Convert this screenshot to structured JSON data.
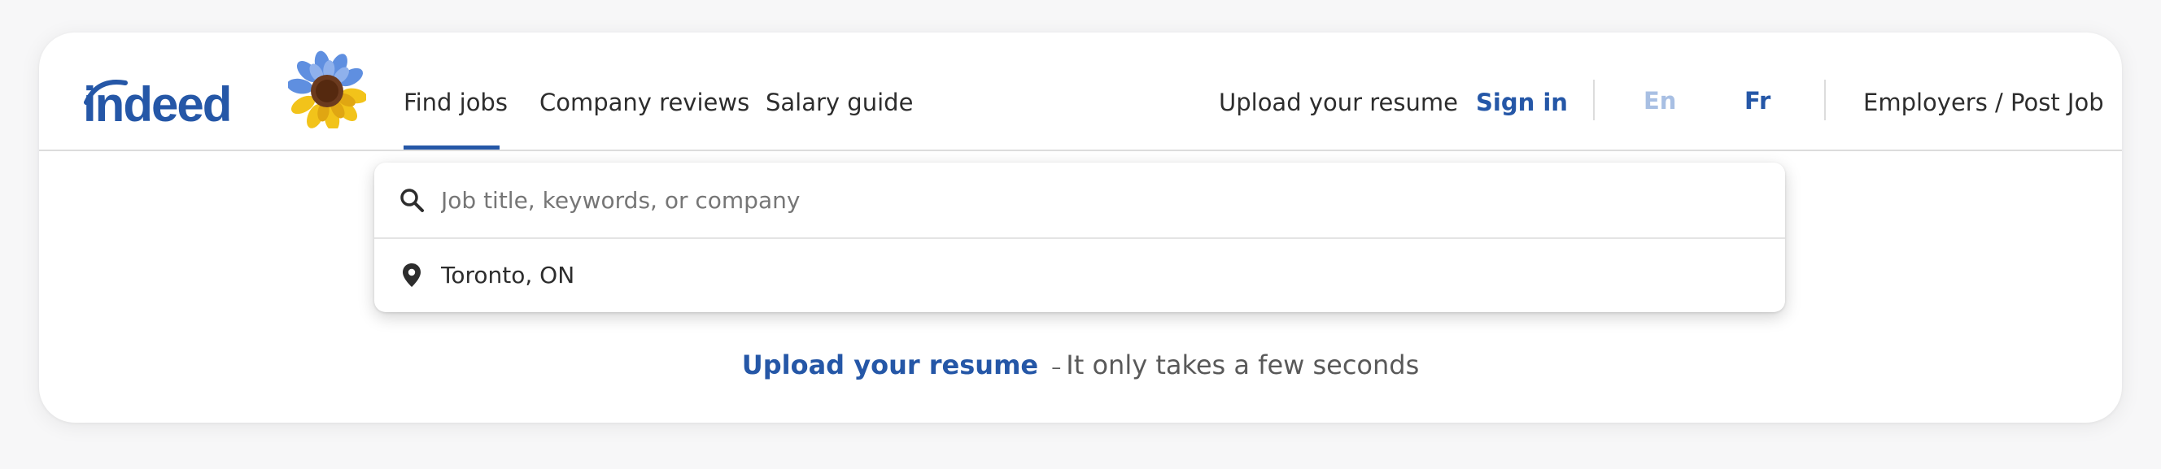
{
  "brand": {
    "logo_text": "indeed",
    "logo_color": "#2557a7"
  },
  "nav": {
    "items": [
      {
        "label": "Find jobs",
        "active": true
      },
      {
        "label": "Company reviews",
        "active": false
      },
      {
        "label": "Salary guide",
        "active": false
      }
    ],
    "right": {
      "upload_resume": "Upload your resume",
      "sign_in": "Sign in",
      "lang_en": "En",
      "lang_fr": "Fr",
      "employers": "Employers / Post Job"
    }
  },
  "search": {
    "what_placeholder": "Job title, keywords, or company",
    "what_value": "",
    "where_value": "Toronto, ON",
    "icons": [
      "search-icon",
      "location-pin-icon"
    ]
  },
  "promo": {
    "link_text": "Upload your resume",
    "separator": "–",
    "tail_text": "It only takes a few seconds"
  },
  "colors": {
    "accent": "#2557a7",
    "text": "#2d2d2d",
    "muted": "#595959",
    "disabled_lang": "#a8bfe3"
  }
}
